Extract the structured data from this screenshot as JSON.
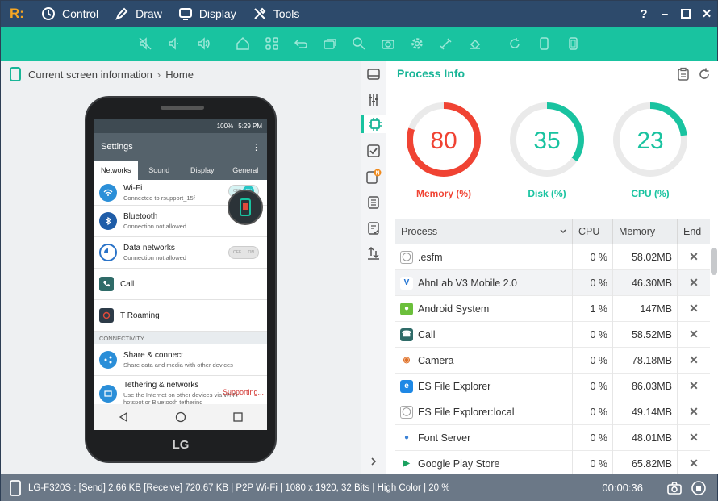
{
  "menu": {
    "control": "Control",
    "draw": "Draw",
    "display": "Display",
    "tools": "Tools",
    "help": "?"
  },
  "breadcrumb": {
    "root": "Current screen information",
    "current": "Home"
  },
  "phone": {
    "brand": "LG",
    "status_battery": "100%",
    "status_time": "5:29 PM",
    "settings_title": "Settings",
    "tabs": [
      "Networks",
      "Sound",
      "Display",
      "General"
    ],
    "rows": {
      "wifi": {
        "title": "Wi-Fi",
        "sub": "Connected to rsupport_15f",
        "toggle_off": "OFF",
        "toggle_on": "ON"
      },
      "bluetooth": {
        "title": "Bluetooth",
        "sub": "Connection not allowed"
      },
      "data": {
        "title": "Data networks",
        "sub": "Connection not allowed",
        "toggle_off": "OFF",
        "toggle_on": "ON"
      },
      "call": {
        "title": "Call"
      },
      "roaming": {
        "title": "T Roaming"
      },
      "section": "CONNECTIVITY",
      "share": {
        "title": "Share & connect",
        "sub": "Share data and media with other devices"
      },
      "tether": {
        "title": "Tethering & networks",
        "sub1": "Use the Internet on other devices via Wi-Fi",
        "sub2": "hotspot or Bluetooth tethering"
      }
    },
    "supporting": "Supporting..."
  },
  "process_info": {
    "title": "Process Info",
    "gauges": [
      {
        "label": "Memory (%)",
        "value": 80,
        "color": "#f04333"
      },
      {
        "label": "Disk (%)",
        "value": 35,
        "color": "#19c3a0"
      },
      {
        "label": "CPU (%)",
        "value": 23,
        "color": "#19c3a0"
      }
    ],
    "columns": {
      "process": "Process",
      "cpu": "CPU",
      "memory": "Memory",
      "end": "End"
    },
    "rows": [
      {
        "name": ".esfm",
        "cpu": "0 %",
        "mem": "58.02MB",
        "icon": "generic"
      },
      {
        "name": "AhnLab V3 Mobile 2.0",
        "cpu": "0 %",
        "mem": "46.30MB",
        "icon": "ahnlab"
      },
      {
        "name": "Android System",
        "cpu": "1 %",
        "mem": "147MB",
        "icon": "android"
      },
      {
        "name": "Call",
        "cpu": "0 %",
        "mem": "58.52MB",
        "icon": "call"
      },
      {
        "name": "Camera",
        "cpu": "0 %",
        "mem": "78.18MB",
        "icon": "camera"
      },
      {
        "name": "ES File Explorer",
        "cpu": "0 %",
        "mem": "86.03MB",
        "icon": "es"
      },
      {
        "name": "ES File Explorer:local",
        "cpu": "0 %",
        "mem": "49.14MB",
        "icon": "generic"
      },
      {
        "name": "Font Server",
        "cpu": "0 %",
        "mem": "48.01MB",
        "icon": "font"
      },
      {
        "name": "Google Play Store",
        "cpu": "0 %",
        "mem": "65.82MB",
        "icon": "play"
      }
    ],
    "end_symbol": "✕"
  },
  "statusbar": {
    "info": "LG-F320S : [Send] 2.66 KB  [Receive] 720.67 KB | P2P Wi-Fi | 1080 x 1920, 32 Bits | High Color | 20 %",
    "timer": "00:00:36"
  }
}
